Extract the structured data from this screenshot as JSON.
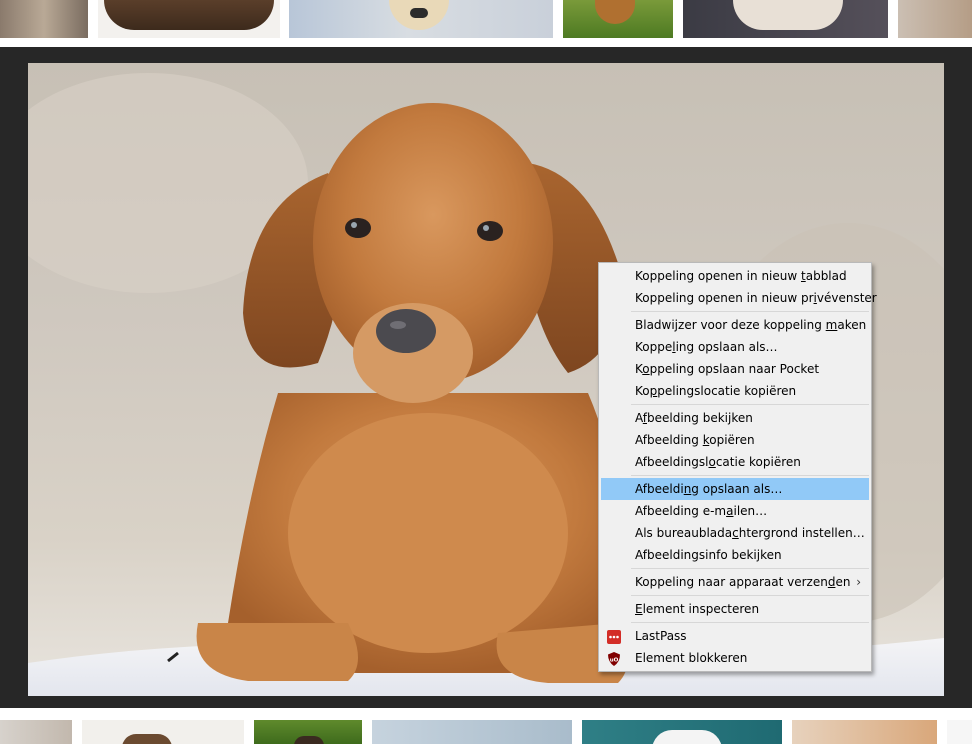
{
  "context_menu": {
    "items": [
      {
        "pre": "Koppeling openen in nieuw ",
        "acc": "t",
        "post": "abblad"
      },
      {
        "pre": "Koppeling openen in nieuw pr",
        "acc": "i",
        "post": "vévenster"
      },
      {
        "pre": "Bladwijzer voor deze koppeling ",
        "acc": "m",
        "post": "aken"
      },
      {
        "pre": "Koppe",
        "acc": "l",
        "post": "ing opslaan als…"
      },
      {
        "pre": "K",
        "acc": "o",
        "post": "ppeling opslaan naar Pocket"
      },
      {
        "pre": "Ko",
        "acc": "p",
        "post": "pelingslocatie kopiëren"
      },
      {
        "pre": "A",
        "acc": "f",
        "post": "beelding bekijken"
      },
      {
        "pre": "Afbeelding ",
        "acc": "k",
        "post": "opiëren"
      },
      {
        "pre": "Afbeeldingsl",
        "acc": "o",
        "post": "catie kopiëren"
      },
      {
        "pre": "Afbeeldi",
        "acc": "n",
        "post": "g opslaan als…"
      },
      {
        "pre": "Afbeelding e-m",
        "acc": "a",
        "post": "ilen…"
      },
      {
        "pre": "Als bureaublada",
        "acc": "c",
        "post": "htergrond instellen…"
      },
      {
        "pre": "Afbeeldingsinfo bekijken",
        "acc": "",
        "post": ""
      },
      {
        "pre": "Koppeling naar apparaat verzen",
        "acc": "d",
        "post": "en"
      },
      {
        "pre": "",
        "acc": "E",
        "post": "lement inspecteren"
      },
      {
        "pre": "LastPass",
        "acc": "",
        "post": ""
      },
      {
        "pre": "Element blokkeren",
        "acc": "",
        "post": ""
      }
    ],
    "submenu_arrow": "›",
    "icons": {
      "lastpass": "lastpass-icon",
      "ublock": "ublock-origin-icon"
    },
    "colors": {
      "highlight": "#91c9f7",
      "menu_bg": "#f0f0f0",
      "lastpass_red": "#d32d27",
      "ublock_red": "#800000"
    }
  },
  "viewer": {
    "background": "#272727"
  }
}
